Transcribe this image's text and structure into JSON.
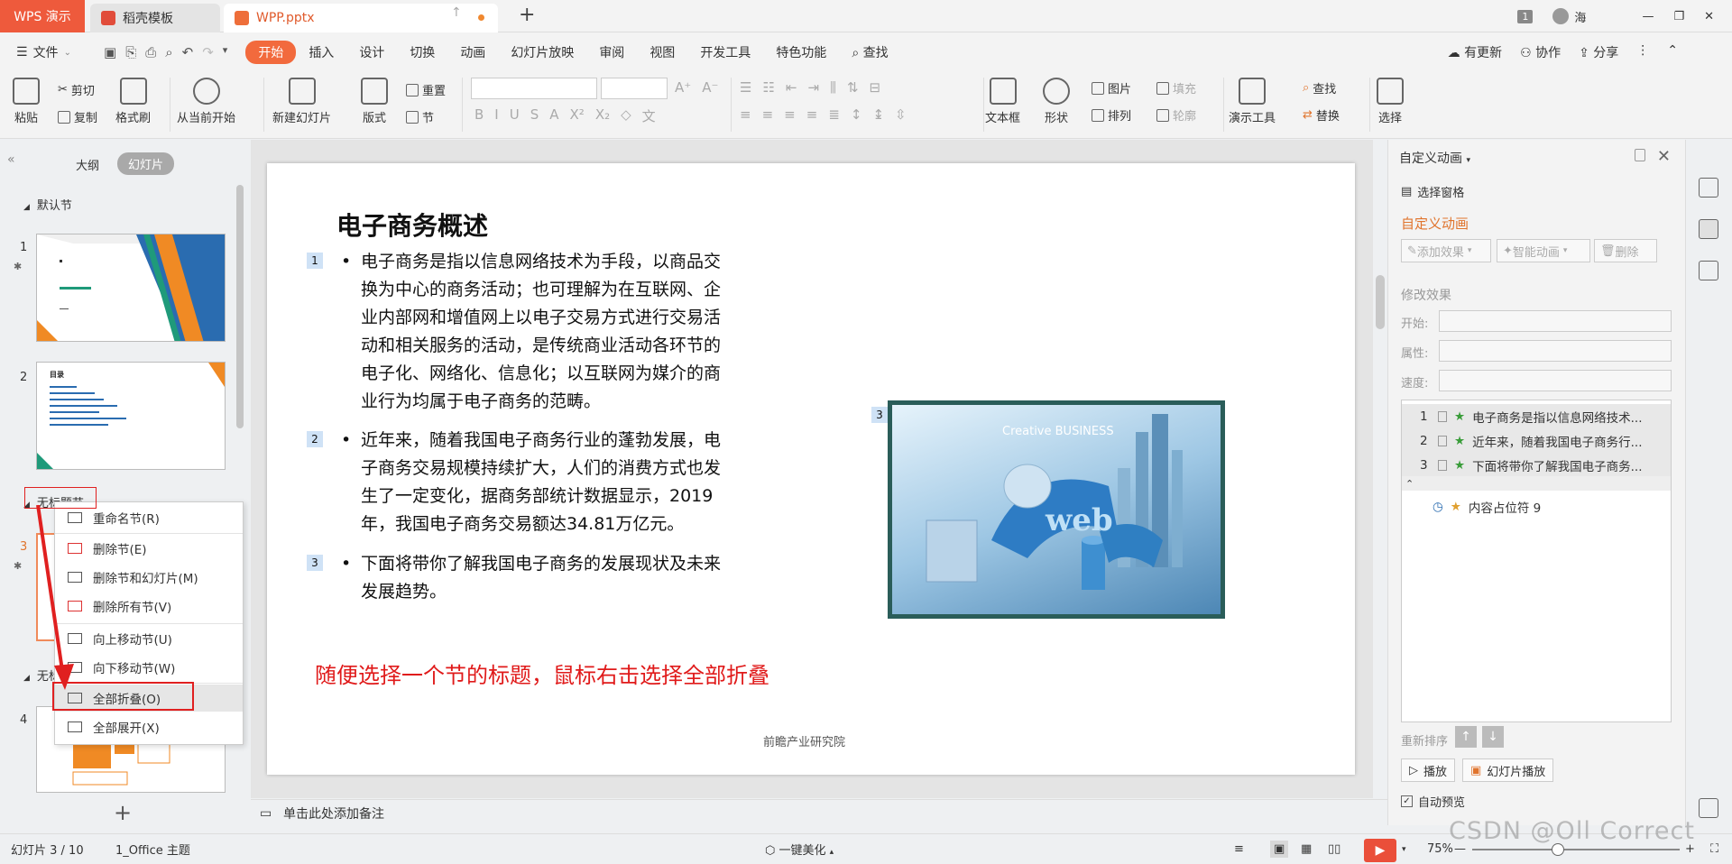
{
  "titlebar": {
    "app_tab": "WPS 演示",
    "tabs": [
      {
        "label": "稻壳模板"
      },
      {
        "label": "WPP.pptx"
      }
    ],
    "user_count": "1",
    "user_name": "海"
  },
  "menubar": {
    "file_label": "文件",
    "tabs": [
      "开始",
      "插入",
      "设计",
      "切换",
      "动画",
      "幻灯片放映",
      "审阅",
      "视图",
      "开发工具",
      "特色功能"
    ],
    "search_label": "查找",
    "right": [
      "有更新",
      "协作",
      "分享"
    ]
  },
  "ribbon": {
    "paste": "粘贴",
    "cut": "剪切",
    "copy": "复制",
    "format_painter": "格式刷",
    "from_current": "从当前开始",
    "new_slide": "新建幻灯片",
    "layout": "版式",
    "reset": "重置",
    "section": "节",
    "textbox": "文本框",
    "shape": "形状",
    "picture": "图片",
    "fill": "填充",
    "arrange": "排列",
    "outline": "轮廓",
    "present_tools": "演示工具",
    "find": "查找",
    "replace": "替换",
    "select": "选择"
  },
  "left_panel": {
    "outline_tab": "大纲",
    "slides_tab": "幻灯片",
    "default_section": "默认节",
    "section_untitled_1": "无标题节",
    "section_untitled_2": "无标",
    "slides": [
      {
        "num": "1"
      },
      {
        "num": "2"
      },
      {
        "num": "3"
      },
      {
        "num": "4"
      }
    ],
    "thumb2_title": "目录"
  },
  "context_menu": {
    "items": [
      "重命名节(R)",
      "删除节(E)",
      "删除节和幻灯片(M)",
      "删除所有节(V)",
      "向上移动节(U)",
      "向下移动节(W)",
      "全部折叠(O)",
      "全部展开(X)"
    ]
  },
  "slide": {
    "title": "电子商务概述",
    "bullets": [
      {
        "tag": "1",
        "text": "电子商务是指以信息网络技术为手段，以商品交换为中心的商务活动；也可理解为在互联网、企业内部网和增值网上以电子交易方式进行交易活动和相关服务的活动，是传统商业活动各环节的电子化、网络化、信息化；以互联网为媒介的商业行为均属于电子商务的范畴。"
      },
      {
        "tag": "2",
        "text": "近年来，随着我国电子商务行业的蓬勃发展，电子商务交易规模持续扩大，人们的消费方式也发生了一定变化，据商务部统计数据显示，2019年，我国电子商务交易额达34.81万亿元。"
      },
      {
        "tag": "3",
        "text": "下面将带你了解我国电子商务的发展现状及未来发展趋势。"
      }
    ],
    "pic_tag": "3",
    "pic_caption": "Creative BUSINESS",
    "pic_word": "web",
    "annotation": "随便选择一个节的标题，鼠标右击选择全部折叠",
    "footer": "前瞻产业研究院"
  },
  "notes": {
    "placeholder": "单击此处添加备注"
  },
  "right_panel": {
    "title": "自定义动画",
    "select_pane": "选择窗格",
    "heading": "自定义动画",
    "add_effect": "添加效果",
    "smart_anim": "智能动画",
    "delete": "删除",
    "modify": "修改效果",
    "start": "开始:",
    "property": "属性:",
    "speed": "速度:",
    "anim_list": [
      {
        "n": "1",
        "text": "电子商务是指以信息网络技术..."
      },
      {
        "n": "2",
        "text": "近年来，随着我国电子商务行..."
      },
      {
        "n": "3",
        "text": "下面将带你了解我国电子商务..."
      }
    ],
    "collapse_marker": "⌃",
    "placeholder_item": "内容占位符 9",
    "reorder": "重新排序",
    "play": "播放",
    "slideshow": "幻灯片播放",
    "auto_preview": "自动预览"
  },
  "status": {
    "slide_info": "幻灯片 3 / 10",
    "theme": "1_Office 主题",
    "beautify": "一键美化",
    "zoom": "75%"
  },
  "watermark": "CSDN @Oll Correct",
  "colors": {
    "accent": "#f26a3d",
    "annotation_red": "#e01a1a",
    "app_tab": "#ee5a3c"
  }
}
